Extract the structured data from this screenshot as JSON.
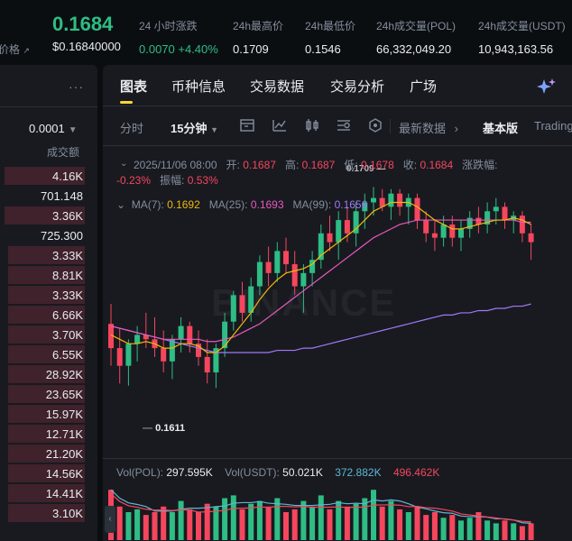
{
  "ticker": {
    "price": "0.1684",
    "fiat_label": "价格",
    "fiat_value": "$0.16840000",
    "stats": [
      {
        "label": "24 小时涨跌",
        "value": "0.0070 +4.40%",
        "green": true
      },
      {
        "label": "24h最高价",
        "value": "0.1709"
      },
      {
        "label": "24h最低价",
        "value": "0.1546"
      },
      {
        "label": "24h成交量(POL)",
        "value": "66,332,049.20"
      },
      {
        "label": "24h成交量(USDT)",
        "value": "10,943,163.56"
      }
    ]
  },
  "trades": {
    "more": "···",
    "step": "0.0001",
    "column_header": "成交额",
    "rows": [
      {
        "v": "4.16K",
        "fill": 0.95
      },
      {
        "v": "701.148",
        "fill": 0.0
      },
      {
        "v": "3.36K",
        "fill": 0.95
      },
      {
        "v": "725.300",
        "fill": 0.0
      },
      {
        "v": "3.33K",
        "fill": 0.9
      },
      {
        "v": "8.81K",
        "fill": 0.9
      },
      {
        "v": "3.33K",
        "fill": 0.9
      },
      {
        "v": "6.66K",
        "fill": 0.9
      },
      {
        "v": "3.70K",
        "fill": 0.9
      },
      {
        "v": "6.55K",
        "fill": 0.9
      },
      {
        "v": "28.92K",
        "fill": 0.9
      },
      {
        "v": "23.65K",
        "fill": 0.9
      },
      {
        "v": "15.97K",
        "fill": 0.9
      },
      {
        "v": "12.71K",
        "fill": 0.9
      },
      {
        "v": "21.20K",
        "fill": 0.9
      },
      {
        "v": "14.56K",
        "fill": 0.9
      },
      {
        "v": "14.41K",
        "fill": 0.9
      },
      {
        "v": "3.10K",
        "fill": 0.9
      }
    ]
  },
  "tabs": [
    "图表",
    "币种信息",
    "交易数据",
    "交易分析",
    "广场"
  ],
  "toolbar": {
    "time": "分时",
    "interval": "15分钟",
    "latest_data": "最新数据",
    "basic": "基本版",
    "trading": "Trading"
  },
  "ohlc": {
    "collapse": "⌄",
    "date": "2025/11/06 08:00",
    "open_label": "开:",
    "open": "0.1687",
    "high_label": "高:",
    "high": "0.1687",
    "low_label": "低:",
    "low": "0.1678",
    "close_label": "收:",
    "close": "0.1684",
    "change_label": "涨跌幅:",
    "change": "-0.23%",
    "amp_label": "振幅:",
    "amp": "0.53%"
  },
  "ma": {
    "collapse": "⌄",
    "ma7_label": "MA(7):",
    "ma7": "0.1692",
    "ma25_label": "MA(25):",
    "ma25": "0.1693",
    "ma99_label": "MA(99):",
    "ma99": "0.1656"
  },
  "annotations": {
    "high": "0.1709",
    "low": "0.1611"
  },
  "watermark": "BINANCE",
  "volume": {
    "pol_label": "Vol(POL):",
    "pol": "297.595K",
    "usdt_label": "Vol(USDT):",
    "usdt": "50.021K",
    "ma1": "372.882K",
    "ma2": "496.462K"
  },
  "chart_data": {
    "type": "candlestick",
    "interval": "15m",
    "candles": [
      [
        0.1647,
        0.1656,
        0.1628,
        0.1636
      ],
      [
        0.1636,
        0.1645,
        0.162,
        0.1628
      ],
      [
        0.1628,
        0.164,
        0.1619,
        0.1638
      ],
      [
        0.1638,
        0.1646,
        0.163,
        0.1642
      ],
      [
        0.1642,
        0.1652,
        0.1636,
        0.164
      ],
      [
        0.164,
        0.165,
        0.1632,
        0.1636
      ],
      [
        0.1636,
        0.1644,
        0.1625,
        0.163
      ],
      [
        0.163,
        0.1642,
        0.1622,
        0.164
      ],
      [
        0.164,
        0.165,
        0.1634,
        0.1646
      ],
      [
        0.1646,
        0.1648,
        0.1634,
        0.1638
      ],
      [
        0.1638,
        0.1644,
        0.1628,
        0.1632
      ],
      [
        0.1632,
        0.164,
        0.162,
        0.1625
      ],
      [
        0.1625,
        0.1638,
        0.1618,
        0.1636
      ],
      [
        0.1636,
        0.1652,
        0.1632,
        0.1648
      ],
      [
        0.1648,
        0.1662,
        0.1644,
        0.166
      ],
      [
        0.166,
        0.1666,
        0.1648,
        0.1652
      ],
      [
        0.1652,
        0.1668,
        0.1648,
        0.1664
      ],
      [
        0.1664,
        0.1678,
        0.166,
        0.1675
      ],
      [
        0.1675,
        0.1682,
        0.1664,
        0.167
      ],
      [
        0.167,
        0.1684,
        0.1666,
        0.168
      ],
      [
        0.168,
        0.1686,
        0.167,
        0.1674
      ],
      [
        0.1674,
        0.168,
        0.166,
        0.1664
      ],
      [
        0.1664,
        0.1674,
        0.1652,
        0.167
      ],
      [
        0.167,
        0.168,
        0.1664,
        0.1676
      ],
      [
        0.1676,
        0.1692,
        0.1672,
        0.1688
      ],
      [
        0.1688,
        0.1696,
        0.168,
        0.1684
      ],
      [
        0.1684,
        0.1698,
        0.1676,
        0.1694
      ],
      [
        0.1694,
        0.17,
        0.1684,
        0.1688
      ],
      [
        0.1688,
        0.1702,
        0.1682,
        0.1698
      ],
      [
        0.1698,
        0.1706,
        0.169,
        0.1702
      ],
      [
        0.1702,
        0.1709,
        0.1696,
        0.1704
      ],
      [
        0.1704,
        0.1708,
        0.1698,
        0.17
      ],
      [
        0.17,
        0.1708,
        0.1694,
        0.1706
      ],
      [
        0.1706,
        0.1708,
        0.1696,
        0.17
      ],
      [
        0.17,
        0.1706,
        0.1692,
        0.1704
      ],
      [
        0.1704,
        0.1706,
        0.169,
        0.1694
      ],
      [
        0.1694,
        0.1698,
        0.1684,
        0.1688
      ],
      [
        0.1688,
        0.1694,
        0.168,
        0.1686
      ],
      [
        0.1686,
        0.1696,
        0.1682,
        0.1692
      ],
      [
        0.1692,
        0.1696,
        0.1682,
        0.1686
      ],
      [
        0.1686,
        0.1694,
        0.168,
        0.169
      ],
      [
        0.169,
        0.1698,
        0.1686,
        0.1695
      ],
      [
        0.1695,
        0.17,
        0.1688,
        0.1692
      ],
      [
        0.1692,
        0.1702,
        0.1688,
        0.1698
      ],
      [
        0.1698,
        0.1704,
        0.1692,
        0.17
      ],
      [
        0.17,
        0.1702,
        0.169,
        0.1694
      ],
      [
        0.1694,
        0.1698,
        0.1688,
        0.1696
      ],
      [
        0.1696,
        0.1698,
        0.1684,
        0.1688
      ],
      [
        0.1688,
        0.1692,
        0.1676,
        0.1684
      ]
    ],
    "ma7": [
      0.1642,
      0.164,
      0.1638,
      0.1638,
      0.1639,
      0.1638,
      0.1636,
      0.1636,
      0.1638,
      0.1638,
      0.1637,
      0.1634,
      0.1634,
      0.1637,
      0.1642,
      0.1647,
      0.1652,
      0.1658,
      0.1663,
      0.1667,
      0.167,
      0.1671,
      0.1672,
      0.1674,
      0.1678,
      0.1681,
      0.1684,
      0.1687,
      0.169,
      0.1694,
      0.1698,
      0.17,
      0.1702,
      0.1702,
      0.1702,
      0.17,
      0.1697,
      0.1694,
      0.1692,
      0.169,
      0.169,
      0.1691,
      0.1692,
      0.1693,
      0.1694,
      0.1694,
      0.1695,
      0.1694,
      0.1692
    ],
    "ma25": [
      0.1646,
      0.1645,
      0.1644,
      0.1643,
      0.1642,
      0.1641,
      0.164,
      0.164,
      0.164,
      0.164,
      0.164,
      0.1639,
      0.1639,
      0.164,
      0.1641,
      0.1643,
      0.1645,
      0.1647,
      0.165,
      0.1653,
      0.1656,
      0.1659,
      0.1662,
      0.1665,
      0.1668,
      0.1671,
      0.1674,
      0.1677,
      0.168,
      0.1683,
      0.1686,
      0.1688,
      0.169,
      0.1692,
      0.1693,
      0.1694,
      0.1694,
      0.1694,
      0.1694,
      0.1694,
      0.1694,
      0.1694,
      0.1694,
      0.1694,
      0.1694,
      0.1694,
      0.1694,
      0.1693,
      0.1693
    ],
    "ma99": [
      0.1646,
      0.1645,
      0.1644,
      0.1643,
      0.1642,
      0.1641,
      0.164,
      0.1639,
      0.1638,
      0.1637,
      0.1636,
      0.1635,
      0.1634,
      0.1634,
      0.1634,
      0.1634,
      0.1634,
      0.1634,
      0.1634,
      0.1635,
      0.1635,
      0.1635,
      0.1636,
      0.1636,
      0.1637,
      0.1638,
      0.1639,
      0.164,
      0.1641,
      0.1642,
      0.1643,
      0.1644,
      0.1645,
      0.1646,
      0.1647,
      0.1648,
      0.1649,
      0.165,
      0.1651,
      0.1651,
      0.1652,
      0.1652,
      0.1653,
      0.1653,
      0.1654,
      0.1654,
      0.1655,
      0.1655,
      0.1656
    ],
    "volume": [
      0.9,
      0.6,
      0.5,
      0.55,
      0.45,
      0.5,
      0.6,
      0.5,
      0.7,
      0.55,
      0.5,
      0.65,
      0.6,
      0.75,
      0.8,
      0.55,
      0.65,
      0.7,
      0.6,
      0.75,
      0.5,
      0.55,
      0.7,
      0.6,
      0.8,
      0.55,
      0.7,
      0.6,
      0.65,
      0.75,
      0.9,
      0.6,
      0.7,
      0.55,
      0.5,
      0.6,
      0.45,
      0.5,
      0.4,
      0.45,
      0.35,
      0.4,
      0.5,
      0.35,
      0.3,
      0.35,
      0.3,
      0.25,
      0.3
    ],
    "ylim": [
      0.1605,
      0.1712
    ]
  }
}
